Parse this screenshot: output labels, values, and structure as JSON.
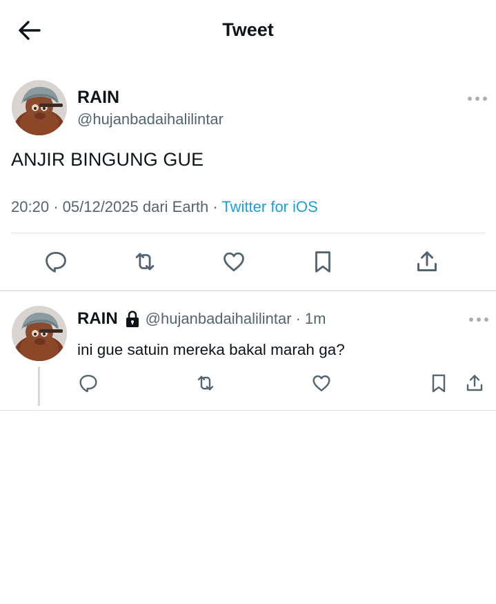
{
  "header": {
    "title": "Tweet",
    "back_icon": "arrow-left-icon"
  },
  "main_tweet": {
    "display_name": "RAIN",
    "handle": "@hujanbadaihalilintar",
    "text": "ANJIR BINGUNG GUE",
    "time": "20:20",
    "date": "05/12/2025",
    "location_text": "dari Earth",
    "source": "Twitter for iOS",
    "actions": [
      "reply-icon",
      "retweet-icon",
      "like-icon",
      "bookmark-icon",
      "share-icon"
    ]
  },
  "reply_tweet": {
    "display_name": "RAIN",
    "handle": "@hujanbadaihalilintar",
    "time_ago": "1m",
    "text": "ini gue satuin mereka bakal marah ga?",
    "protected_icon": "lock-icon",
    "actions": [
      "reply-icon",
      "retweet-icon",
      "like-icon",
      "bookmark-icon",
      "share-icon"
    ]
  },
  "colors": {
    "text_primary": "#0f1419",
    "text_secondary": "#536471",
    "link": "#1a9fd9",
    "icon": "#536471",
    "divider": "#dfe3e6"
  }
}
